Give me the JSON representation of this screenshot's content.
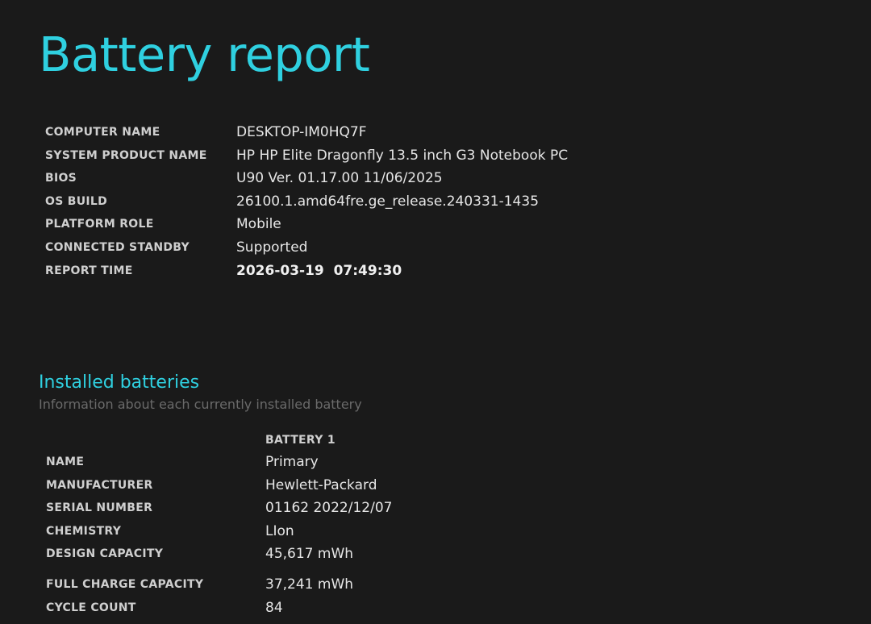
{
  "report": {
    "title": "Battery report"
  },
  "system_info": [
    {
      "label": "COMPUTER NAME",
      "value": "DESKTOP-IM0HQ7F"
    },
    {
      "label": "SYSTEM PRODUCT NAME",
      "value": "HP HP Elite Dragonfly 13.5 inch G3 Notebook PC"
    },
    {
      "label": "BIOS",
      "value": "U90 Ver. 01.17.00 11/06/2025"
    },
    {
      "label": "OS BUILD",
      "value": "26100.1.amd64fre.ge_release.240331-1435"
    },
    {
      "label": "PLATFORM ROLE",
      "value": "Mobile"
    },
    {
      "label": "CONNECTED STANDBY",
      "value": "Supported"
    },
    {
      "label": "REPORT TIME",
      "value": "2026-03-19  07:49:30"
    }
  ],
  "installed_batteries": {
    "title": "Installed batteries",
    "subtitle": "Information about each currently installed battery",
    "column_header": "BATTERY 1",
    "rows": [
      {
        "label": "NAME",
        "value": "Primary"
      },
      {
        "label": "MANUFACTURER",
        "value": "Hewlett-Packard"
      },
      {
        "label": "SERIAL NUMBER",
        "value": "01162 2022/12/07"
      },
      {
        "label": "CHEMISTRY",
        "value": "LIon"
      },
      {
        "label": "DESIGN CAPACITY",
        "value": "45,617 mWh"
      },
      {
        "label": "FULL CHARGE CAPACITY",
        "value": "37,241 mWh"
      },
      {
        "label": "CYCLE COUNT",
        "value": "84"
      }
    ]
  },
  "colors": {
    "background": "#1a1a1a",
    "accent": "#2fd0e0",
    "text": "#e6e6e6",
    "muted": "#6a6a6a"
  }
}
